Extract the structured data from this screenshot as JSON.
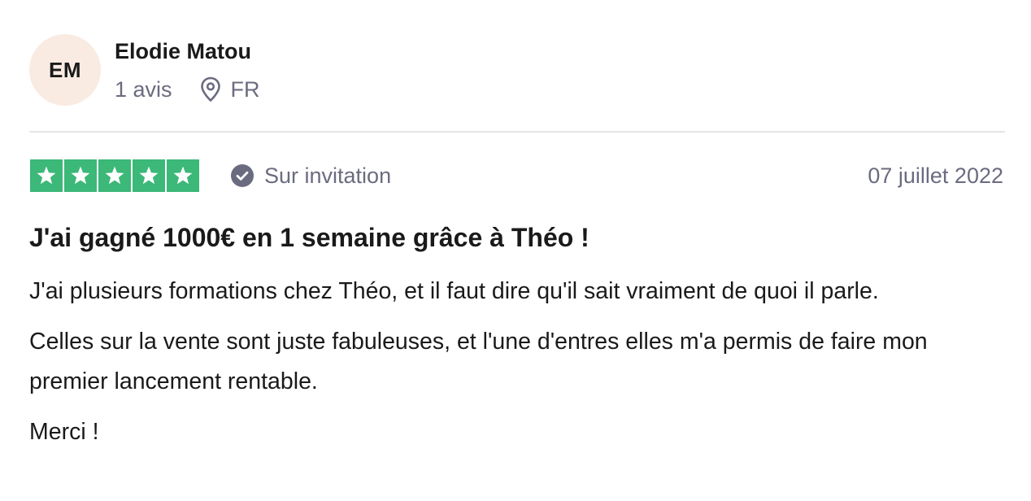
{
  "reviewer": {
    "initials": "EM",
    "name": "Elodie Matou",
    "review_count": "1 avis",
    "location_icon": "location-pin-icon",
    "country": "FR"
  },
  "review": {
    "rating": 5,
    "rating_color": "#3cb878",
    "verification_icon": "check-circle-icon",
    "verification_label": "Sur invitation",
    "date": "07 juillet 2022",
    "title": "J'ai gagné 1000€ en 1 semaine grâce à Théo !",
    "paragraphs": [
      "J'ai plusieurs formations chez Théo, et il faut dire qu'il sait vraiment de quoi il parle.",
      "Celles sur la vente sont juste fabuleuses, et l'une d'entres elles m'a permis de faire mon premier lancement rentable.",
      "Merci !"
    ]
  }
}
